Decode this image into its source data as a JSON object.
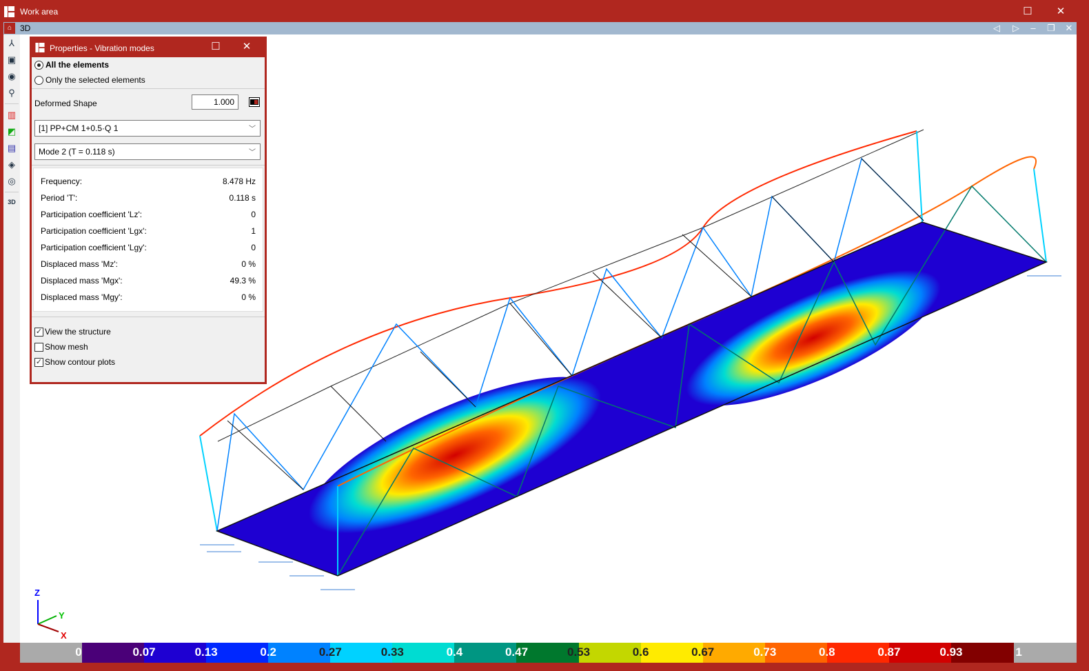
{
  "window": {
    "title": "Work area",
    "maximize_icon": "maximize-icon",
    "close_icon": "close-icon"
  },
  "view": {
    "tab_label": "3D"
  },
  "panel": {
    "title": "Properties - Vibration modes",
    "scope_options": [
      "All the elements",
      "Only the selected elements"
    ],
    "selected_scope": "All the elements",
    "deformed_label": "Deformed Shape",
    "deformed_value": "1.000",
    "combination": "[1] PP+CM 1+0.5·Q 1",
    "mode": "Mode 2 (T = 0.118 s)",
    "rows": [
      {
        "k": "Frequency:",
        "v": "8.478  Hz"
      },
      {
        "k": "Period 'T':",
        "v": "0.118 s"
      },
      {
        "k": "Participation coefficient 'Lz':",
        "v": "0"
      },
      {
        "k": "Participation coefficient 'Lgx':",
        "v": "1"
      },
      {
        "k": "Participation coefficient 'Lgy':",
        "v": "0"
      },
      {
        "k": "Displaced mass 'Mz':",
        "v": "0 %"
      },
      {
        "k": "Displaced mass 'Mgx':",
        "v": "49.3 %"
      },
      {
        "k": "Displaced mass 'Mgy':",
        "v": "0 %"
      }
    ],
    "checks": [
      {
        "label": "View the structure",
        "checked": true
      },
      {
        "label": "Show mesh",
        "checked": false
      },
      {
        "label": "Show contour plots",
        "checked": true
      }
    ]
  },
  "axes": {
    "z": "Z",
    "y": "Y",
    "x": "X"
  },
  "legend": {
    "labels": [
      "0",
      "0.07",
      "0.13",
      "0.2",
      "0.27",
      "0.33",
      "0.4",
      "0.47",
      "0.53",
      "0.6",
      "0.67",
      "0.73",
      "0.8",
      "0.87",
      "0.93",
      "1"
    ],
    "colors": [
      "#4a0078",
      "#1e00d2",
      "#0028ff",
      "#0082ff",
      "#00d2ff",
      "#00dcd2",
      "#009682",
      "#00782d",
      "#c3d700",
      "#ffeb00",
      "#ffaa00",
      "#ff6400",
      "#ff2800",
      "#d20000",
      "#820000"
    ],
    "dark_labels": [
      "0.27",
      "0.33",
      "0.53",
      "0.6",
      "0.67"
    ]
  }
}
